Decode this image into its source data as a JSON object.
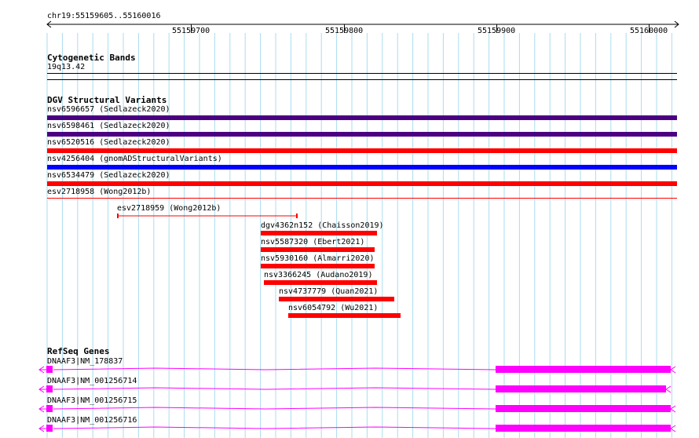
{
  "colors": {
    "grid": "#aaddee",
    "purple": "#4b0082",
    "red": "#ff0000",
    "blue": "#0000ff",
    "magenta": "#ff00ff",
    "ruler": "#000000"
  },
  "ruler": {
    "location": "chr19:55159605..55160016",
    "ticks": [
      {
        "label": "55159700"
      },
      {
        "label": "55159800"
      },
      {
        "label": "55159900"
      },
      {
        "label": "55160000"
      }
    ]
  },
  "cytobands": {
    "title": "Cytogenetic Bands",
    "band": "19q13.42"
  },
  "dgv": {
    "title": "DGV Structural Variants",
    "full_width": [
      {
        "label": "nsv6596657 (Sedlazeck2020)",
        "color": "purple"
      },
      {
        "label": "nsv6598461 (Sedlazeck2020)",
        "color": "purple"
      },
      {
        "label": "nsv6520516 (Sedlazeck2020)",
        "color": "red"
      },
      {
        "label": "nsv4256404 (gnomADStructuralVariants)",
        "color": "blue"
      },
      {
        "label": "nsv6534479 (Sedlazeck2020)",
        "color": "red"
      },
      {
        "label": "esv2718958 (Wong2012b)",
        "color": "red"
      }
    ],
    "partial": [
      {
        "label": "esv2718959 (Wong2012b)"
      },
      {
        "label": "dgv4362n152 (Chaisson2019)"
      },
      {
        "label": "nsv5587320 (Ebert2021)"
      },
      {
        "label": "nsv5930160 (Almarri2020)"
      },
      {
        "label": "nsv3366245 (Audano2019)"
      },
      {
        "label": "nsv4737779 (Quan2021)"
      },
      {
        "label": "nsv6054792 (Wu2021)"
      }
    ]
  },
  "refseq": {
    "title": "RefSeq Genes",
    "genes": [
      {
        "label": "DNAAF3|NM_178837"
      },
      {
        "label": "DNAAF3|NM_001256714"
      },
      {
        "label": "DNAAF3|NM_001256715"
      },
      {
        "label": "DNAAF3|NM_001256716"
      }
    ]
  }
}
